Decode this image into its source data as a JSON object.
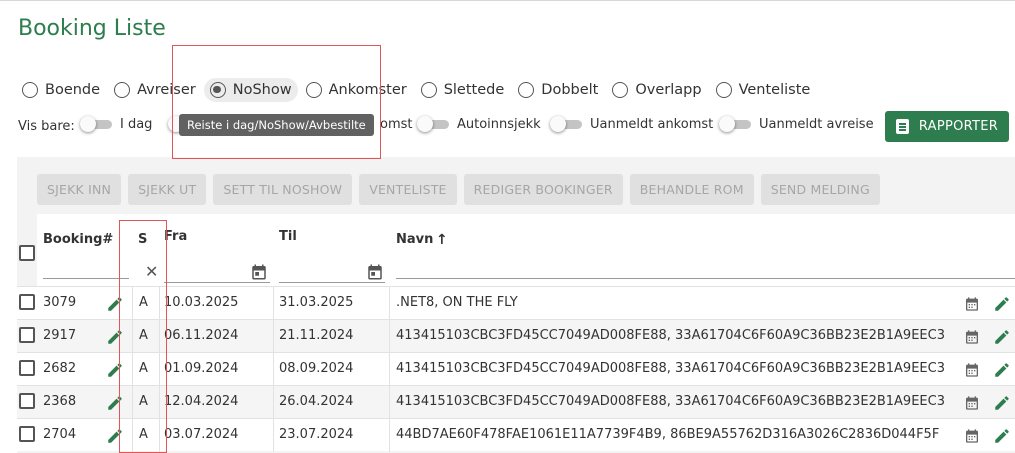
{
  "title": "Booking Liste",
  "filters": [
    {
      "label": "Boende",
      "selected": false
    },
    {
      "label": "Avreiser",
      "selected": false
    },
    {
      "label": "NoShow",
      "selected": true
    },
    {
      "label": "Ankomster",
      "selected": false
    },
    {
      "label": "Slettede",
      "selected": false
    },
    {
      "label": "Dobbelt",
      "selected": false
    },
    {
      "label": "Overlapp",
      "selected": false
    },
    {
      "label": "Venteliste",
      "selected": false
    }
  ],
  "vis_bare_label": "Vis bare:",
  "toggles": [
    {
      "label": "I dag",
      "on": false
    },
    {
      "label": "omst",
      "on": false
    },
    {
      "label": "Autoinnsjekk",
      "on": false
    },
    {
      "label": "Uanmeldt ankomst",
      "on": false
    },
    {
      "label": "Uanmeldt avreise",
      "on": false
    }
  ],
  "tooltip": "Reiste i dag/NoShow/Avbestilte",
  "rapporter_label": "RAPPORTER",
  "actions": [
    "SJEKK INN",
    "SJEKK UT",
    "SETT TIL NOSHOW",
    "VENTELISTE",
    "REDIGER BOOKINGER",
    "BEHANDLE ROM",
    "SEND MELDING"
  ],
  "columns": {
    "booking": "Booking#",
    "s": "S",
    "fra": "Fra",
    "til": "Til",
    "navn": "Navn"
  },
  "sort_arrow": "↑",
  "clear_symbol": "✕",
  "rows": [
    {
      "booking": "3079",
      "s": "A",
      "fra": "10.03.2025",
      "til": "31.03.2025",
      "navn": ".NET8, ON THE FLY"
    },
    {
      "booking": "2917",
      "s": "A",
      "fra": "06.11.2024",
      "til": "21.11.2024",
      "navn": "413415103CBC3FD45CC7049AD008FE88, 33A61704C6F60A9C36BB23E2B1A9EEC3"
    },
    {
      "booking": "2682",
      "s": "A",
      "fra": "01.09.2024",
      "til": "08.09.2024",
      "navn": "413415103CBC3FD45CC7049AD008FE88, 33A61704C6F60A9C36BB23E2B1A9EEC3"
    },
    {
      "booking": "2368",
      "s": "A",
      "fra": "12.04.2024",
      "til": "26.04.2024",
      "navn": "413415103CBC3FD45CC7049AD008FE88, 33A61704C6F60A9C36BB23E2B1A9EEC3"
    },
    {
      "booking": "2704",
      "s": "A",
      "fra": "03.07.2024",
      "til": "23.07.2024",
      "navn": "44BD7AE60F478FAE1061E11A7739F4B9, 86BE9A55762D316A3026C2836D044F5F"
    }
  ],
  "colors": {
    "accent": "#2e7d4f",
    "highlight_box": "#e05555",
    "tooltip_bg": "#616161"
  },
  "icons": [
    "radio-icon",
    "report-icon",
    "calendar-icon",
    "pencil-icon",
    "clear-icon",
    "sort-up-icon"
  ]
}
